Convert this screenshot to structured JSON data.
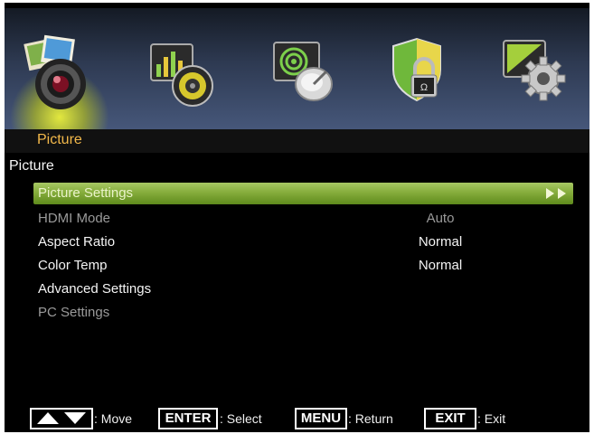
{
  "tabs": [
    {
      "icon": "picture-camera-icon",
      "active": true
    },
    {
      "icon": "audio-speaker-icon",
      "active": false
    },
    {
      "icon": "channel-satellite-icon",
      "active": false
    },
    {
      "icon": "lock-shield-icon",
      "active": false
    },
    {
      "icon": "setup-gear-icon",
      "active": false
    }
  ],
  "header": {
    "tab_title": "Picture"
  },
  "menu": {
    "title": "Picture",
    "items": [
      {
        "label": "Picture Settings",
        "value": "",
        "selected": true,
        "enabled": true
      },
      {
        "label": "HDMI Mode",
        "value": "Auto",
        "selected": false,
        "enabled": false
      },
      {
        "label": "Aspect Ratio",
        "value": "Normal",
        "selected": false,
        "enabled": true
      },
      {
        "label": "Color Temp",
        "value": "Normal",
        "selected": false,
        "enabled": true
      },
      {
        "label": "Advanced Settings",
        "value": "",
        "selected": false,
        "enabled": true
      },
      {
        "label": "PC Settings",
        "value": "",
        "selected": false,
        "enabled": false
      }
    ]
  },
  "footer": {
    "move": {
      "key_icon": "up-down-arrows-icon",
      "hint": ": Move"
    },
    "select": {
      "key": "ENTER",
      "hint": ": Select"
    },
    "return": {
      "key": "MENU",
      "hint": ": Return"
    },
    "exit": {
      "key": "EXIT",
      "hint": ": Exit"
    }
  },
  "colors": {
    "tab_title": "#f2b84a",
    "selected_row": "#86ad3c",
    "disabled_text": "#9a9a9a",
    "enabled_text": "#f4f4f4"
  }
}
